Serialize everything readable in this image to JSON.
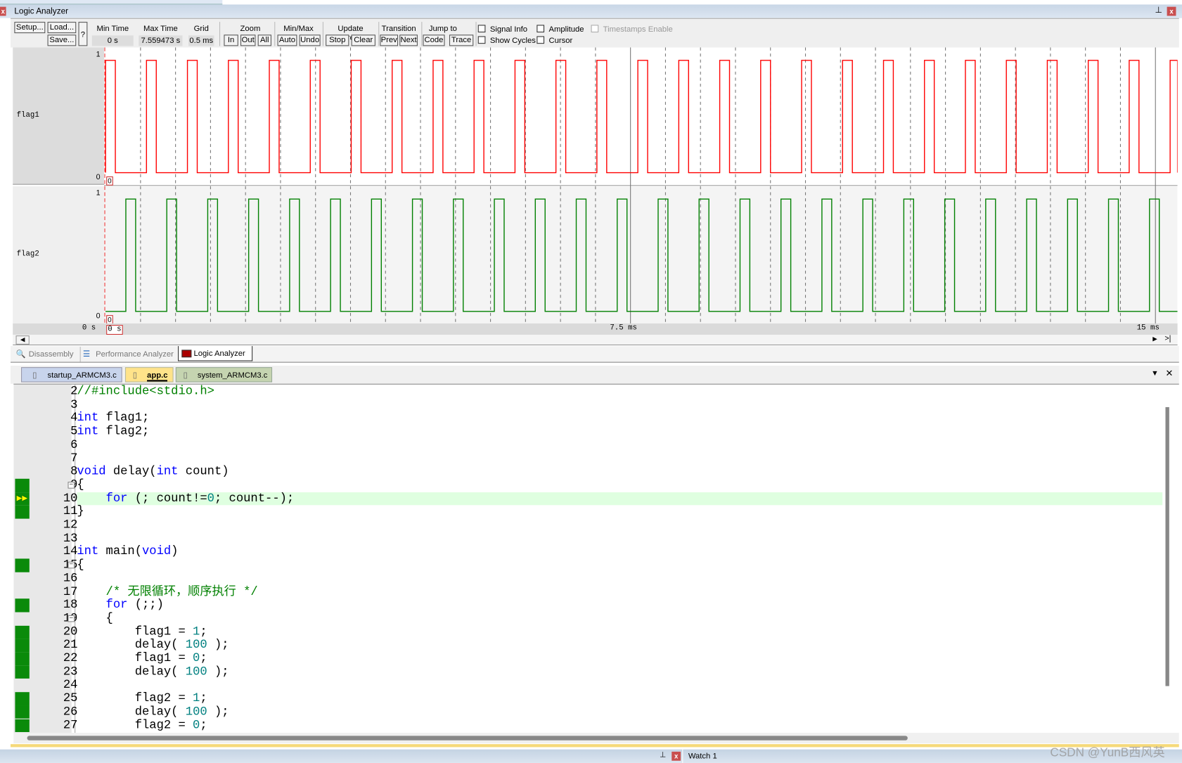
{
  "window": {
    "title": "Logic Analyzer",
    "close": "x"
  },
  "toolbar": {
    "setup": "Setup...",
    "load": "Load...",
    "save": "Save...",
    "help": "?",
    "min_time_label": "Min Time",
    "min_time": "0 s",
    "max_time_label": "Max Time",
    "max_time": "7.559473 s",
    "grid_label": "Grid",
    "grid": "0.5 ms",
    "zoom_label": "Zoom",
    "zoom_in": "In",
    "zoom_out": "Out",
    "zoom_all": "All",
    "minmax_label": "Min/Max",
    "auto": "Auto",
    "undo": "Undo",
    "update_label": "Update Screen",
    "stop": "Stop",
    "clear": "Clear",
    "transition_label": "Transition",
    "prev": "Prev",
    "next": "Next",
    "jump_label": "Jump to",
    "code": "Code",
    "trace": "Trace",
    "signal_info": "Signal Info",
    "show_cycles": "Show Cycles",
    "amplitude": "Amplitude",
    "cursor": "Cursor",
    "timestamps": "Timestamps Enable"
  },
  "signals": [
    {
      "name": "flag1",
      "high": "1",
      "low": "0",
      "marker": "0",
      "color": "#ff0000",
      "period_ms": 0.585,
      "high_ms": 0.14,
      "offset_ms": 0.0
    },
    {
      "name": "flag2",
      "high": "1",
      "low": "0",
      "marker": "0",
      "color": "#008000",
      "period_ms": 0.585,
      "high_ms": 0.14,
      "offset_ms": 0.29
    }
  ],
  "time_axis": {
    "start": "0 s",
    "cursor": "0 s",
    "mid": "7.5 ms",
    "end": "15 ms",
    "range_ms": 15.1,
    "grid_ms": 0.5
  },
  "bottom_tabs": [
    {
      "label": "Disassembly"
    },
    {
      "label": "Performance Analyzer"
    },
    {
      "label": "Logic Analyzer",
      "active": true
    }
  ],
  "file_tabs": [
    {
      "label": "startup_ARMCM3.c"
    },
    {
      "label": "app.c",
      "active": true
    },
    {
      "label": "system_ARMCM3.c"
    }
  ],
  "code": {
    "current_line": 10,
    "breakpoint_lines": [
      9,
      10,
      11,
      15,
      18,
      20,
      21,
      22,
      23,
      25,
      26,
      27
    ],
    "fold_lines": [
      9,
      15,
      19
    ],
    "lines": [
      {
        "n": "2",
        "s": [
          {
            "c": "cm",
            "t": "//#include<stdio.h>"
          }
        ]
      },
      {
        "n": "3",
        "s": []
      },
      {
        "n": "4",
        "s": [
          {
            "c": "kw",
            "t": "int"
          },
          {
            "c": "pl",
            "t": " flag1;"
          }
        ]
      },
      {
        "n": "5",
        "s": [
          {
            "c": "kw",
            "t": "int"
          },
          {
            "c": "pl",
            "t": " flag2;"
          }
        ]
      },
      {
        "n": "6",
        "s": []
      },
      {
        "n": "7",
        "s": []
      },
      {
        "n": "8",
        "s": [
          {
            "c": "kw",
            "t": "void"
          },
          {
            "c": "pl",
            "t": " delay("
          },
          {
            "c": "kw",
            "t": "int"
          },
          {
            "c": "pl",
            "t": " count)"
          }
        ]
      },
      {
        "n": "9",
        "s": [
          {
            "c": "pl",
            "t": "{"
          }
        ]
      },
      {
        "n": "10",
        "s": [
          {
            "c": "pl",
            "t": "    "
          },
          {
            "c": "kw",
            "t": "for"
          },
          {
            "c": "pl",
            "t": " (; count!="
          },
          {
            "c": "nm",
            "t": "0"
          },
          {
            "c": "pl",
            "t": "; count--);"
          }
        ]
      },
      {
        "n": "11",
        "s": [
          {
            "c": "pl",
            "t": "}"
          }
        ]
      },
      {
        "n": "12",
        "s": []
      },
      {
        "n": "13",
        "s": []
      },
      {
        "n": "14",
        "s": [
          {
            "c": "kw",
            "t": "int"
          },
          {
            "c": "pl",
            "t": " main("
          },
          {
            "c": "kw",
            "t": "void"
          },
          {
            "c": "pl",
            "t": ")"
          }
        ]
      },
      {
        "n": "15",
        "s": [
          {
            "c": "pl",
            "t": "{"
          }
        ]
      },
      {
        "n": "16",
        "s": []
      },
      {
        "n": "17",
        "s": [
          {
            "c": "cm",
            "t": "    /* 无限循环，顺序执行 */"
          }
        ]
      },
      {
        "n": "18",
        "s": [
          {
            "c": "pl",
            "t": "    "
          },
          {
            "c": "kw",
            "t": "for"
          },
          {
            "c": "pl",
            "t": " (;;)"
          }
        ]
      },
      {
        "n": "19",
        "s": [
          {
            "c": "pl",
            "t": "    {"
          }
        ]
      },
      {
        "n": "20",
        "s": [
          {
            "c": "pl",
            "t": "        flag1 = "
          },
          {
            "c": "nm",
            "t": "1"
          },
          {
            "c": "pl",
            "t": ";"
          }
        ]
      },
      {
        "n": "21",
        "s": [
          {
            "c": "pl",
            "t": "        delay( "
          },
          {
            "c": "nm",
            "t": "100"
          },
          {
            "c": "pl",
            "t": " );"
          }
        ]
      },
      {
        "n": "22",
        "s": [
          {
            "c": "pl",
            "t": "        flag1 = "
          },
          {
            "c": "nm",
            "t": "0"
          },
          {
            "c": "pl",
            "t": ";"
          }
        ]
      },
      {
        "n": "23",
        "s": [
          {
            "c": "pl",
            "t": "        delay( "
          },
          {
            "c": "nm",
            "t": "100"
          },
          {
            "c": "pl",
            "t": " );"
          }
        ]
      },
      {
        "n": "24",
        "s": []
      },
      {
        "n": "25",
        "s": [
          {
            "c": "pl",
            "t": "        flag2 = "
          },
          {
            "c": "nm",
            "t": "1"
          },
          {
            "c": "pl",
            "t": ";"
          }
        ]
      },
      {
        "n": "26",
        "s": [
          {
            "c": "pl",
            "t": "        delay( "
          },
          {
            "c": "nm",
            "t": "100"
          },
          {
            "c": "pl",
            "t": " );"
          }
        ]
      },
      {
        "n": "27",
        "s": [
          {
            "c": "pl",
            "t": "        flag2 = "
          },
          {
            "c": "nm",
            "t": "0"
          },
          {
            "c": "pl",
            "t": ";"
          }
        ]
      }
    ]
  },
  "status": {
    "watch_tab": "Watch 1",
    "watermark": "CSDN @YunB西风英"
  }
}
